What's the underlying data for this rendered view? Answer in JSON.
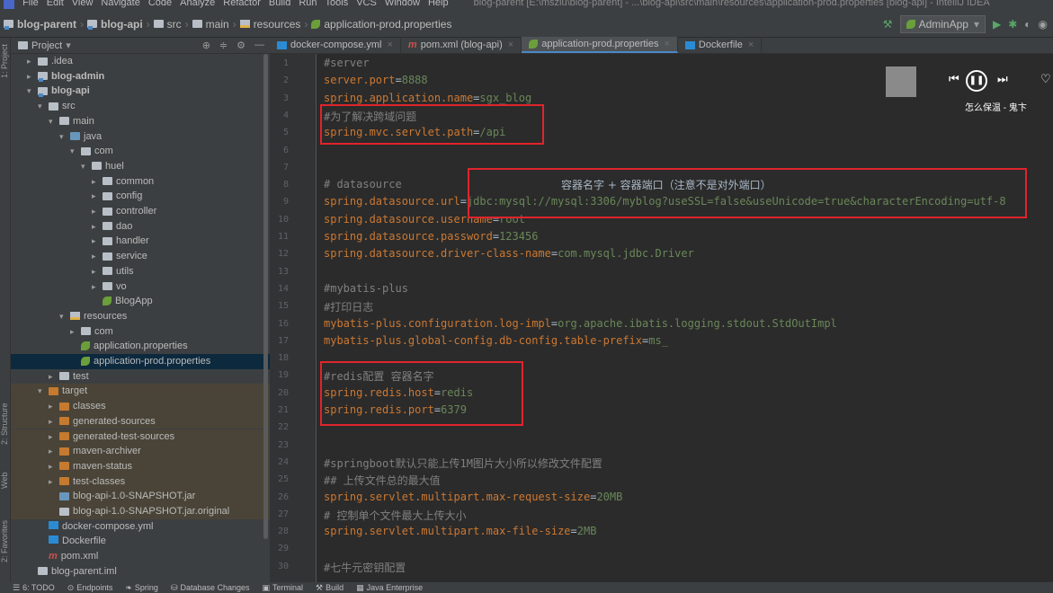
{
  "menubar": {
    "items": [
      "File",
      "Edit",
      "View",
      "Navigate",
      "Code",
      "Analyze",
      "Refactor",
      "Build",
      "Run",
      "Tools",
      "VCS",
      "Window",
      "Help"
    ],
    "title": "blog-parent [E:\\mszlu\\blog-parent] - ...\\blog-api\\src\\main\\resources\\application-prod.properties [blog-api] - IntelliJ IDEA"
  },
  "breadcrumb": [
    "blog-parent",
    "blog-api",
    "src",
    "main",
    "resources",
    "application-prod.properties"
  ],
  "run_config": "AdminApp",
  "project_panel": {
    "title": "Project"
  },
  "tree": [
    {
      "label": ".idea",
      "depth": 1,
      "arrow": "▸",
      "icon": "folder"
    },
    {
      "label": "blog-admin",
      "depth": 1,
      "arrow": "▸",
      "icon": "folder-mod",
      "bold": true
    },
    {
      "label": "blog-api",
      "depth": 1,
      "arrow": "▾",
      "icon": "folder-mod",
      "bold": true
    },
    {
      "label": "src",
      "depth": 2,
      "arrow": "▾",
      "icon": "folder"
    },
    {
      "label": "main",
      "depth": 3,
      "arrow": "▾",
      "icon": "folder"
    },
    {
      "label": "java",
      "depth": 4,
      "arrow": "▾",
      "icon": "folder-blue"
    },
    {
      "label": "com",
      "depth": 5,
      "arrow": "▾",
      "icon": "folder"
    },
    {
      "label": "huel",
      "depth": 6,
      "arrow": "▾",
      "icon": "folder"
    },
    {
      "label": "common",
      "depth": 7,
      "arrow": "▸",
      "icon": "folder"
    },
    {
      "label": "config",
      "depth": 7,
      "arrow": "▸",
      "icon": "folder"
    },
    {
      "label": "controller",
      "depth": 7,
      "arrow": "▸",
      "icon": "folder"
    },
    {
      "label": "dao",
      "depth": 7,
      "arrow": "▸",
      "icon": "folder"
    },
    {
      "label": "handler",
      "depth": 7,
      "arrow": "▸",
      "icon": "folder"
    },
    {
      "label": "service",
      "depth": 7,
      "arrow": "▸",
      "icon": "folder"
    },
    {
      "label": "utils",
      "depth": 7,
      "arrow": "▸",
      "icon": "folder"
    },
    {
      "label": "vo",
      "depth": 7,
      "arrow": "▸",
      "icon": "folder"
    },
    {
      "label": "BlogApp",
      "depth": 7,
      "arrow": "",
      "icon": "class"
    },
    {
      "label": "resources",
      "depth": 4,
      "arrow": "▾",
      "icon": "resources"
    },
    {
      "label": "com",
      "depth": 5,
      "arrow": "▸",
      "icon": "folder"
    },
    {
      "label": "application.properties",
      "depth": 5,
      "arrow": "",
      "icon": "leaf"
    },
    {
      "label": "application-prod.properties",
      "depth": 5,
      "arrow": "",
      "icon": "leaf",
      "selected": true
    },
    {
      "label": "test",
      "depth": 3,
      "arrow": "▸",
      "icon": "folder"
    },
    {
      "label": "target",
      "depth": 2,
      "arrow": "▾",
      "icon": "folder-orange",
      "target": true
    },
    {
      "label": "classes",
      "depth": 3,
      "arrow": "▸",
      "icon": "folder-orange",
      "target": true
    },
    {
      "label": "generated-sources",
      "depth": 3,
      "arrow": "▸",
      "icon": "folder-orange",
      "target": true
    },
    {
      "label": "generated-test-sources",
      "depth": 3,
      "arrow": "▸",
      "icon": "folder-orange",
      "target": true
    },
    {
      "label": "maven-archiver",
      "depth": 3,
      "arrow": "▸",
      "icon": "folder-orange",
      "target": true
    },
    {
      "label": "maven-status",
      "depth": 3,
      "arrow": "▸",
      "icon": "folder-orange",
      "target": true
    },
    {
      "label": "test-classes",
      "depth": 3,
      "arrow": "▸",
      "icon": "folder-orange",
      "target": true
    },
    {
      "label": "blog-api-1.0-SNAPSHOT.jar",
      "depth": 3,
      "arrow": "",
      "icon": "jar",
      "target": true
    },
    {
      "label": "blog-api-1.0-SNAPSHOT.jar.original",
      "depth": 3,
      "arrow": "",
      "icon": "file",
      "target": true
    },
    {
      "label": "docker-compose.yml",
      "depth": 2,
      "arrow": "",
      "icon": "docker"
    },
    {
      "label": "Dockerfile",
      "depth": 2,
      "arrow": "",
      "icon": "docker"
    },
    {
      "label": "pom.xml",
      "depth": 2,
      "arrow": "",
      "icon": "maven"
    },
    {
      "label": "blog-parent.iml",
      "depth": 1,
      "arrow": "",
      "icon": "iml"
    }
  ],
  "tabs": [
    {
      "label": "docker-compose.yml",
      "icon": "docker"
    },
    {
      "label": "pom.xml (blog-api)",
      "icon": "maven"
    },
    {
      "label": "application-prod.properties",
      "icon": "leaf",
      "active": true
    },
    {
      "label": "Dockerfile",
      "icon": "docker"
    }
  ],
  "line_numbers": [
    "1",
    "2",
    "3",
    "4",
    "5",
    "6",
    "7",
    "8",
    "9",
    "10",
    "11",
    "12",
    "13",
    "14",
    "15",
    "16",
    "17",
    "18",
    "19",
    "20",
    "21",
    "22",
    "23",
    "24",
    "25",
    "26",
    "27",
    "28",
    "29",
    "30"
  ],
  "code_lines": [
    [
      [
        "#server",
        "cmt"
      ]
    ],
    [
      [
        "server.port",
        "key"
      ],
      [
        "=",
        "eq"
      ],
      [
        "8888",
        "val"
      ]
    ],
    [
      [
        "spring.application.name",
        "key"
      ],
      [
        "=",
        "eq"
      ],
      [
        "sgx_blog",
        "val"
      ]
    ],
    [
      [
        "#为了解决跨域问题",
        "cmt"
      ]
    ],
    [
      [
        "spring.mvc.servlet.path",
        "key"
      ],
      [
        "=",
        "eq"
      ],
      [
        "/api",
        "val"
      ]
    ],
    [],
    [],
    [
      [
        "# datasource",
        "cmt"
      ]
    ],
    [
      [
        "spring.datasource.url",
        "key"
      ],
      [
        "=",
        "eq"
      ],
      [
        "jdbc:mysql://mysql:3306/myblog?useSSL=false&useUnicode=true&characterEncoding=utf-8",
        "val"
      ]
    ],
    [
      [
        "spring.datasource.username",
        "key"
      ],
      [
        "=",
        "eq"
      ],
      [
        "root",
        "val"
      ]
    ],
    [
      [
        "spring.datasource.password",
        "key"
      ],
      [
        "=",
        "eq"
      ],
      [
        "123456",
        "val"
      ]
    ],
    [
      [
        "spring.datasource.driver-class-name",
        "key"
      ],
      [
        "=",
        "eq"
      ],
      [
        "com.mysql.jdbc.Driver",
        "val"
      ]
    ],
    [],
    [
      [
        "#mybatis-plus",
        "cmt"
      ]
    ],
    [
      [
        "#打印日志",
        "cmt"
      ]
    ],
    [
      [
        "mybatis-plus.configuration.log-impl",
        "key"
      ],
      [
        "=",
        "eq"
      ],
      [
        "org.apache.ibatis.logging.stdout.StdOutImpl",
        "val"
      ]
    ],
    [
      [
        "mybatis-plus.global-config.db-config.table-prefix",
        "key"
      ],
      [
        "=",
        "eq"
      ],
      [
        "ms_",
        "val"
      ]
    ],
    [],
    [
      [
        "#redis配置 容器名字",
        "cmt"
      ]
    ],
    [
      [
        "spring.redis.host",
        "key"
      ],
      [
        "=",
        "eq"
      ],
      [
        "redis",
        "val"
      ]
    ],
    [
      [
        "spring.redis.port",
        "key"
      ],
      [
        "=",
        "eq"
      ],
      [
        "6379",
        "val"
      ]
    ],
    [],
    [],
    [
      [
        "#springboot默认只能上传1M图片大小所以修改文件配置",
        "cmt"
      ]
    ],
    [
      [
        "## 上传文件总的最大值",
        "cmt"
      ]
    ],
    [
      [
        "spring.servlet.multipart.max-request-size",
        "key"
      ],
      [
        "=",
        "eq"
      ],
      [
        "20MB",
        "val"
      ]
    ],
    [
      [
        "# 控制单个文件最大上传大小",
        "cmt"
      ]
    ],
    [
      [
        "spring.servlet.multipart.max-file-size",
        "key"
      ],
      [
        "=",
        "eq"
      ],
      [
        "2MB",
        "val"
      ]
    ],
    [],
    [
      [
        "#七牛元密钥配置",
        "cmt"
      ]
    ]
  ],
  "annotation_text": "容器名字 + 容器端口（注意不是对外端口）",
  "player": {
    "song": "怎么保温 - 鬼卞"
  },
  "statusbar": [
    "6: TODO",
    "Endpoints",
    "Spring",
    "Database Changes",
    "Terminal",
    "Build",
    "Java Enterprise"
  ],
  "sidebar_labels": [
    "1: Project",
    "2: Structure",
    "Web",
    "2: Favorites"
  ]
}
